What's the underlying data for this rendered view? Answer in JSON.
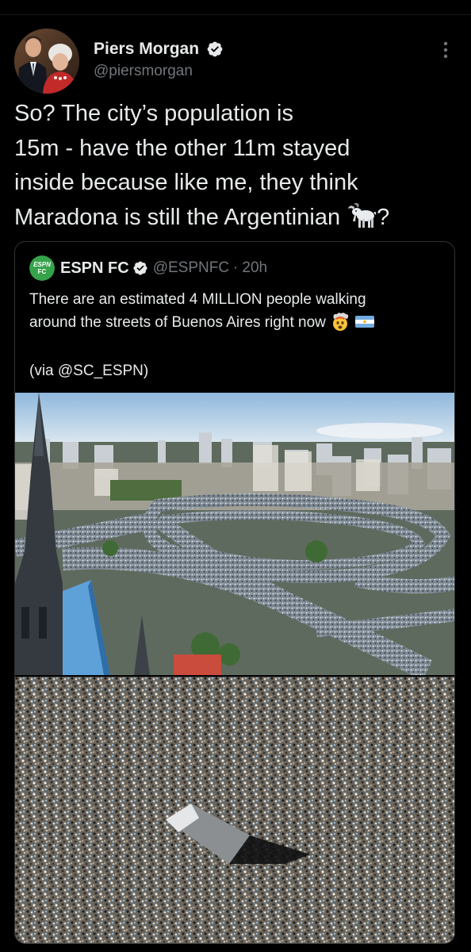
{
  "tweet": {
    "author": {
      "display_name": "Piers Morgan",
      "handle": "@piersmorgan",
      "verified": true
    },
    "text_lines": [
      "So? The city’s population is",
      "15m - have the other 11m stayed",
      "inside because like me, they think",
      "Maradona is still the Argentinian"
    ],
    "trailing_emoji": "goat",
    "trailing_text": "?"
  },
  "quoted_tweet": {
    "author": {
      "display_name": "ESPN FC",
      "handle": "@ESPNFC",
      "verified": true
    },
    "separator": "·",
    "time": "20h",
    "text_lines": [
      "There are an estimated 4 MILLION people walking",
      "around the streets of Buenos Aires right now"
    ],
    "trailing_emojis": [
      "exploding-head",
      "argentina-flag"
    ],
    "via": "(via @SC_ESPN)"
  },
  "colors": {
    "background": "#000000",
    "text_primary": "#e7e9ea",
    "text_secondary": "#71767b",
    "border": "#2f3336",
    "verified_blue": "#1d9bf0",
    "espn_green": "#36a34a"
  },
  "icons": {
    "verified": "verified-badge-icon",
    "more": "more-options-icon",
    "goat": "goat-icon"
  }
}
